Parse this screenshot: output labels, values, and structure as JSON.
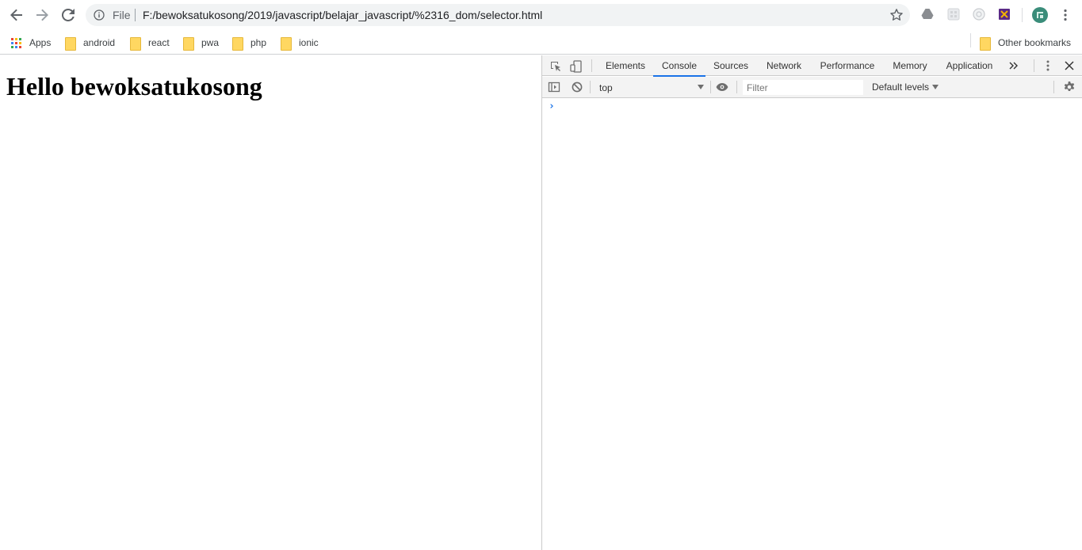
{
  "toolbar": {
    "scheme_label": "File",
    "url": "F:/bewoksatukosong/2019/javascript/belajar_javascript/%2316_dom/selector.html"
  },
  "bookmarks": {
    "apps_label": "Apps",
    "folders": [
      "android",
      "react",
      "pwa",
      "php",
      "ionic"
    ],
    "other_label": "Other bookmarks"
  },
  "page": {
    "heading": "Hello bewoksatukosong"
  },
  "devtools": {
    "tabs": [
      "Elements",
      "Console",
      "Sources",
      "Network",
      "Performance",
      "Memory",
      "Application"
    ],
    "active_tab": "Console",
    "context": "top",
    "filter_placeholder": "Filter",
    "levels_label": "Default levels",
    "prompt": "›"
  },
  "colors": {
    "accent": "#1a73e8",
    "folder": "#ffd761"
  }
}
